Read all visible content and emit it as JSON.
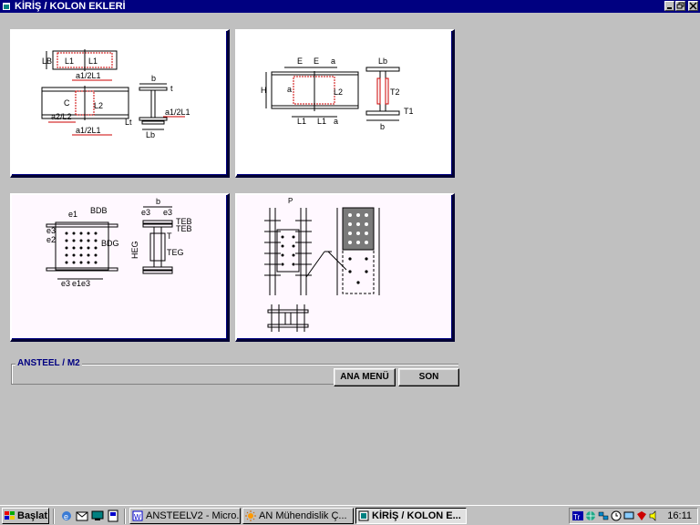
{
  "window": {
    "title": "KİRİŞ / KOLON EKLERİ"
  },
  "panels": {
    "beam_splice_flange": {
      "labels": [
        "LB",
        "L1",
        "L1",
        "a1/2L1",
        "C",
        "L2",
        "a2/L2",
        "a1/2L1",
        "b",
        "t",
        "Lt",
        "a1/2L1",
        "Lb"
      ]
    },
    "beam_splice_web": {
      "labels": [
        "E",
        "E",
        "a",
        "a",
        "H",
        "L2",
        "L1",
        "L1",
        "a",
        "Lb",
        "T2",
        "T1",
        "b"
      ]
    },
    "column_splice": {
      "labels": [
        "e1",
        "BDB",
        "e3",
        "e2",
        "BDG",
        "e3",
        "e1",
        "e3",
        "b",
        "e3",
        "e3",
        "TEB",
        "TEB",
        "T",
        "HEG",
        "TEG"
      ]
    },
    "column_detail": {
      "labels": [
        "P"
      ]
    }
  },
  "group": {
    "legend": "ANSTEEL   / M2"
  },
  "buttons": {
    "main_menu": "ANA MENÜ",
    "end": "SON"
  },
  "taskbar": {
    "start": "Başlat",
    "tasks": [
      {
        "label": "ANSTEELV2 - Micro..."
      },
      {
        "label": "AN Mühendislik     Ç..."
      },
      {
        "label": "KİRİŞ / KOLON E..."
      }
    ],
    "tray_icons": [
      "tr-flag-icon",
      "globe-icon",
      "network-icon",
      "speaker-icon"
    ],
    "clock": "16:11"
  },
  "colors": {
    "titlebar": "#000080",
    "face": "#c0c0c0",
    "drawing_red": "#cc0000"
  }
}
